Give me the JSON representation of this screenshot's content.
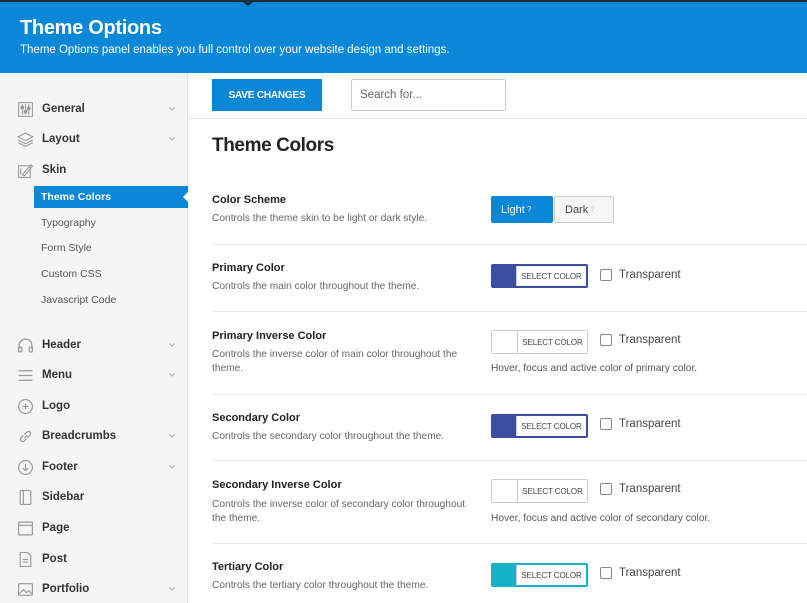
{
  "banner": {
    "title": "Theme Options",
    "subtitle": "Theme Options panel enables you full control over your website design and settings."
  },
  "toolbar": {
    "save_label": "SAVE CHANGES",
    "search_placeholder": "Search for..."
  },
  "sidebar": {
    "items": [
      {
        "label": "General",
        "icon": "sliders-icon",
        "expandable": true
      },
      {
        "label": "Layout",
        "icon": "layers-icon",
        "expandable": true
      },
      {
        "label": "Skin",
        "icon": "paint-icon",
        "expandable": false
      },
      {
        "label": "Header",
        "icon": "headphones-icon",
        "expandable": true
      },
      {
        "label": "Menu",
        "icon": "menu-icon",
        "expandable": true
      },
      {
        "label": "Logo",
        "icon": "plus-circle-icon",
        "expandable": false
      },
      {
        "label": "Breadcrumbs",
        "icon": "link-icon",
        "expandable": true
      },
      {
        "label": "Footer",
        "icon": "arrow-down-circle-icon",
        "expandable": true
      },
      {
        "label": "Sidebar",
        "icon": "sidebar-icon",
        "expandable": false
      },
      {
        "label": "Page",
        "icon": "page-icon",
        "expandable": false
      },
      {
        "label": "Post",
        "icon": "post-icon",
        "expandable": false
      },
      {
        "label": "Portfolio",
        "icon": "image-icon",
        "expandable": true
      }
    ],
    "skin_subitems": [
      {
        "label": "Theme Colors",
        "active": true
      },
      {
        "label": "Typography",
        "active": false
      },
      {
        "label": "Form Style",
        "active": false
      },
      {
        "label": "Custom CSS",
        "active": false
      },
      {
        "label": "Javascript Code",
        "active": false
      }
    ]
  },
  "main": {
    "section_title": "Theme Colors",
    "color_scheme": {
      "title": "Color Scheme",
      "description": "Controls the theme skin to be light or dark style.",
      "options": [
        "Light",
        "Dark"
      ],
      "selected": "Light",
      "help_glyph": "?"
    },
    "settings": [
      {
        "title": "Primary Color",
        "description": "Controls the main color throughout the theme.",
        "color": "#3c4c9e",
        "picker_label": "SELECT COLOR",
        "transparent_label": "Transparent",
        "hint": ""
      },
      {
        "title": "Primary Inverse Color",
        "description": "Controls the inverse color of main color throughout the theme.",
        "color": "#ffffff",
        "picker_label": "SELECT COLOR",
        "transparent_label": "Transparent",
        "hint": "Hover, focus and active color of primary color."
      },
      {
        "title": "Secondary Color",
        "description": "Controls the secondary color throughout the theme.",
        "color": "#3c4c9e",
        "picker_label": "SELECT COLOR",
        "transparent_label": "Transparent",
        "hint": ""
      },
      {
        "title": "Secondary Inverse Color",
        "description": "Controls the inverse color of secondary color throughout the theme.",
        "color": "#ffffff",
        "picker_label": "SELECT COLOR",
        "transparent_label": "Transparent",
        "hint": "Hover, focus and active color of secondary color."
      },
      {
        "title": "Tertiary Color",
        "description": "Controls the tertiary color throughout the theme.",
        "color": "#14b2c6",
        "picker_label": "SELECT COLOR",
        "transparent_label": "Transparent",
        "hint": ""
      }
    ]
  },
  "colors": {
    "accent": "#0a87d6",
    "header_dark": "#1f2c3a"
  }
}
